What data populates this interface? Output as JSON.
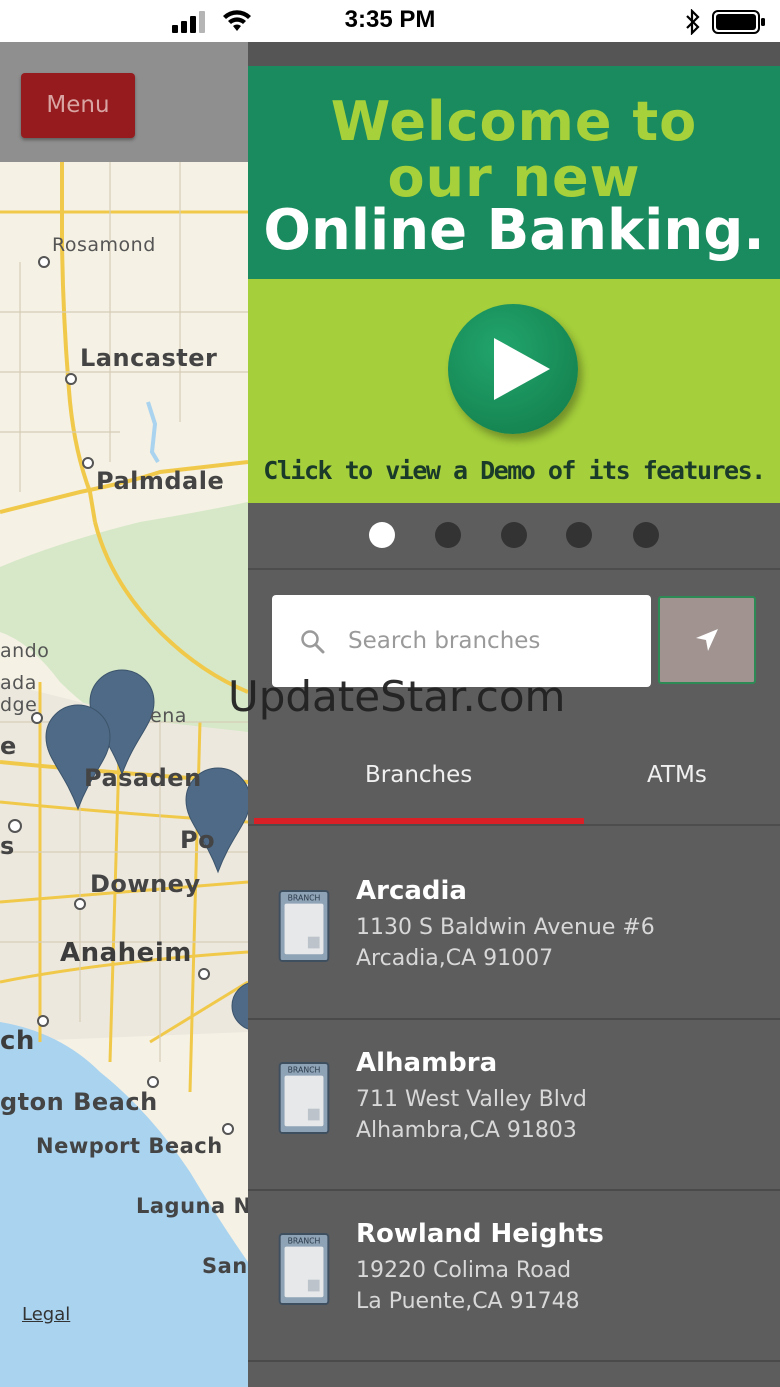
{
  "status_bar": {
    "time": "3:35 PM"
  },
  "map_header": {
    "menu_label": "Menu"
  },
  "map": {
    "labels": {
      "rosamond": "Rosamond",
      "lancaster": "Lancaster",
      "palmdale": "Palmdale",
      "ando": "ando",
      "ada": "ada",
      "dge": "dge",
      "ena": "ena",
      "pasadena": "Pasaden",
      "pomona": "Po",
      "downey": "Downey",
      "anaheim": "Anaheim",
      "ch": "ch",
      "huntington": "gton Beach",
      "newport": "Newport Beach",
      "laguna": "Laguna N",
      "san": "San",
      "s": "s",
      "e": "e"
    },
    "legal": "Legal"
  },
  "banner": {
    "line1": "Welcome to",
    "line2": "our new",
    "line3": "Online Banking.",
    "caption": "Click to view a Demo of its features.",
    "colors": {
      "top": "#198b5e",
      "bottom": "#a5cf3b",
      "headline": "#a6d13a"
    }
  },
  "carousel": {
    "count": 5,
    "active": 1
  },
  "search": {
    "placeholder": "Search branches"
  },
  "tabs": {
    "branches": "Branches",
    "atms": "ATMs",
    "active_color": "#d92027"
  },
  "branches": [
    {
      "name": "Arcadia",
      "address1": "1130 S Baldwin Avenue #6",
      "address2": "Arcadia,CA 91007"
    },
    {
      "name": "Alhambra",
      "address1": "711 West Valley Blvd",
      "address2": "Alhambra,CA 91803"
    },
    {
      "name": "Rowland Heights",
      "address1": "19220 Colima Road",
      "address2": "La Puente,CA 91748"
    }
  ],
  "watermark": "UpdateStar.com"
}
